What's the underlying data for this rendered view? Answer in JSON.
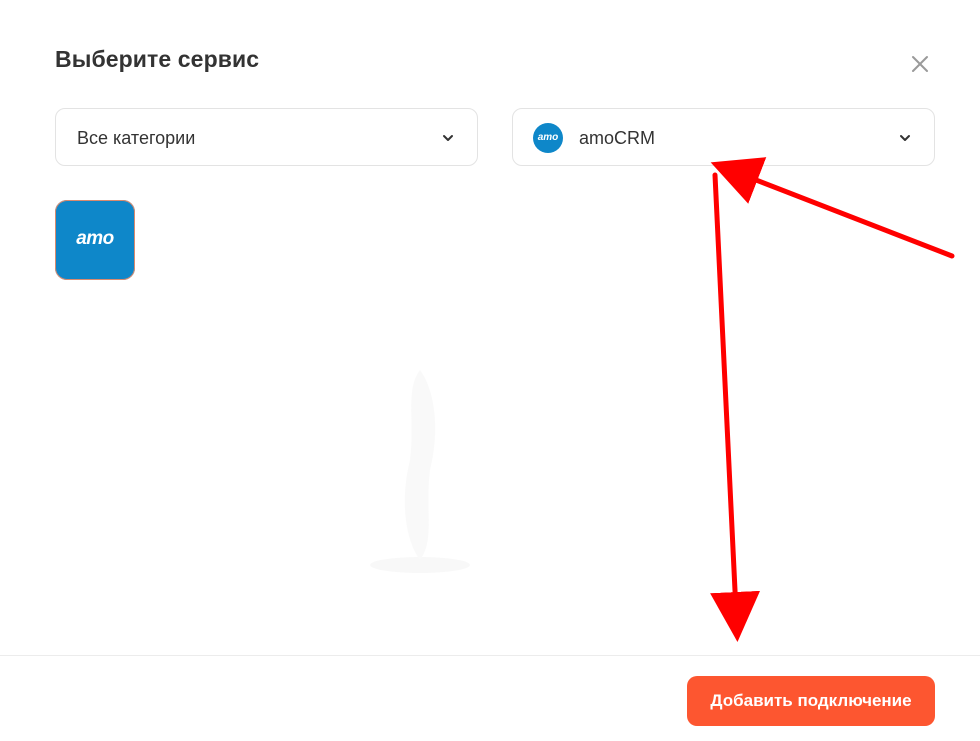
{
  "dialog": {
    "title": "Выберите сервис",
    "close_icon": "close-icon"
  },
  "filters": {
    "category": {
      "selected": "Все категории",
      "icon": "chevron-down-icon"
    },
    "service": {
      "selected": "amoCRM",
      "logo_text": "amo",
      "icon": "chevron-down-icon"
    }
  },
  "services": [
    {
      "logo_text": "amo",
      "color": "#0e87c9"
    }
  ],
  "footer": {
    "add_button_label": "Добавить подключение",
    "accent_color": "#fd5630"
  },
  "annotations": {
    "arrow_color": "#ff0000",
    "arrows": 2
  }
}
